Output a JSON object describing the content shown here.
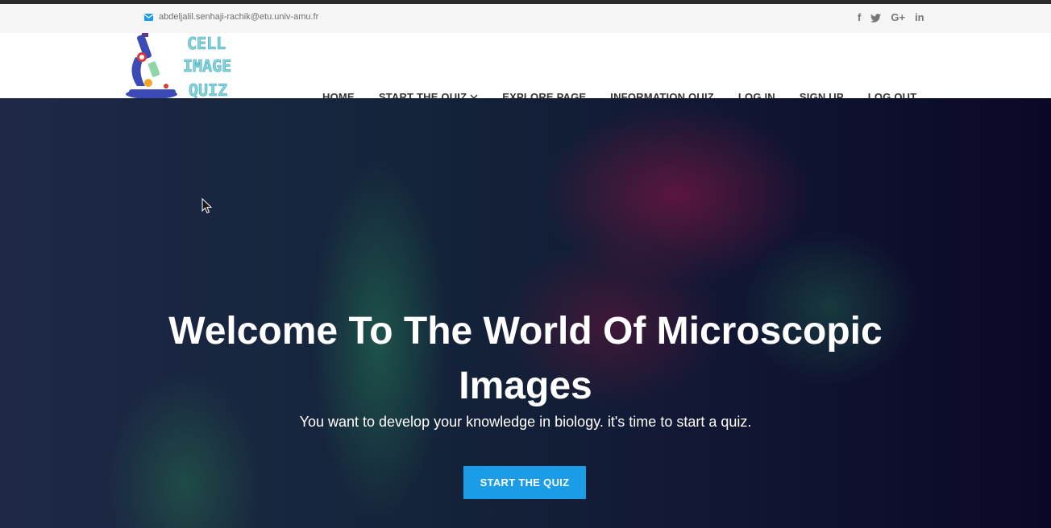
{
  "topbar": {
    "email": "abdeljalil.senhaji-rachik@etu.univ-amu.fr",
    "social": {
      "facebook": "f",
      "twitter": "🐦",
      "google": "G+",
      "linkedin": "in"
    }
  },
  "brand": {
    "logo_text_lines": [
      "CELL",
      "IMAGE",
      "QUIZ"
    ],
    "logo_color": "#7fd6e0"
  },
  "nav": {
    "items": [
      "HOME",
      "START THE QUIZ",
      "EXPLORE PAGE",
      "INFORMATION QUIZ",
      "LOG IN",
      "SIGN UP",
      "LOG OUT"
    ]
  },
  "hero": {
    "title": "Welcome To The World Of Microscopic Images",
    "subtitle": "You want to develop your knowledge in biology. it's time to start a quiz.",
    "button": "START THE QUIZ",
    "button_color": "#1a9ce6"
  }
}
